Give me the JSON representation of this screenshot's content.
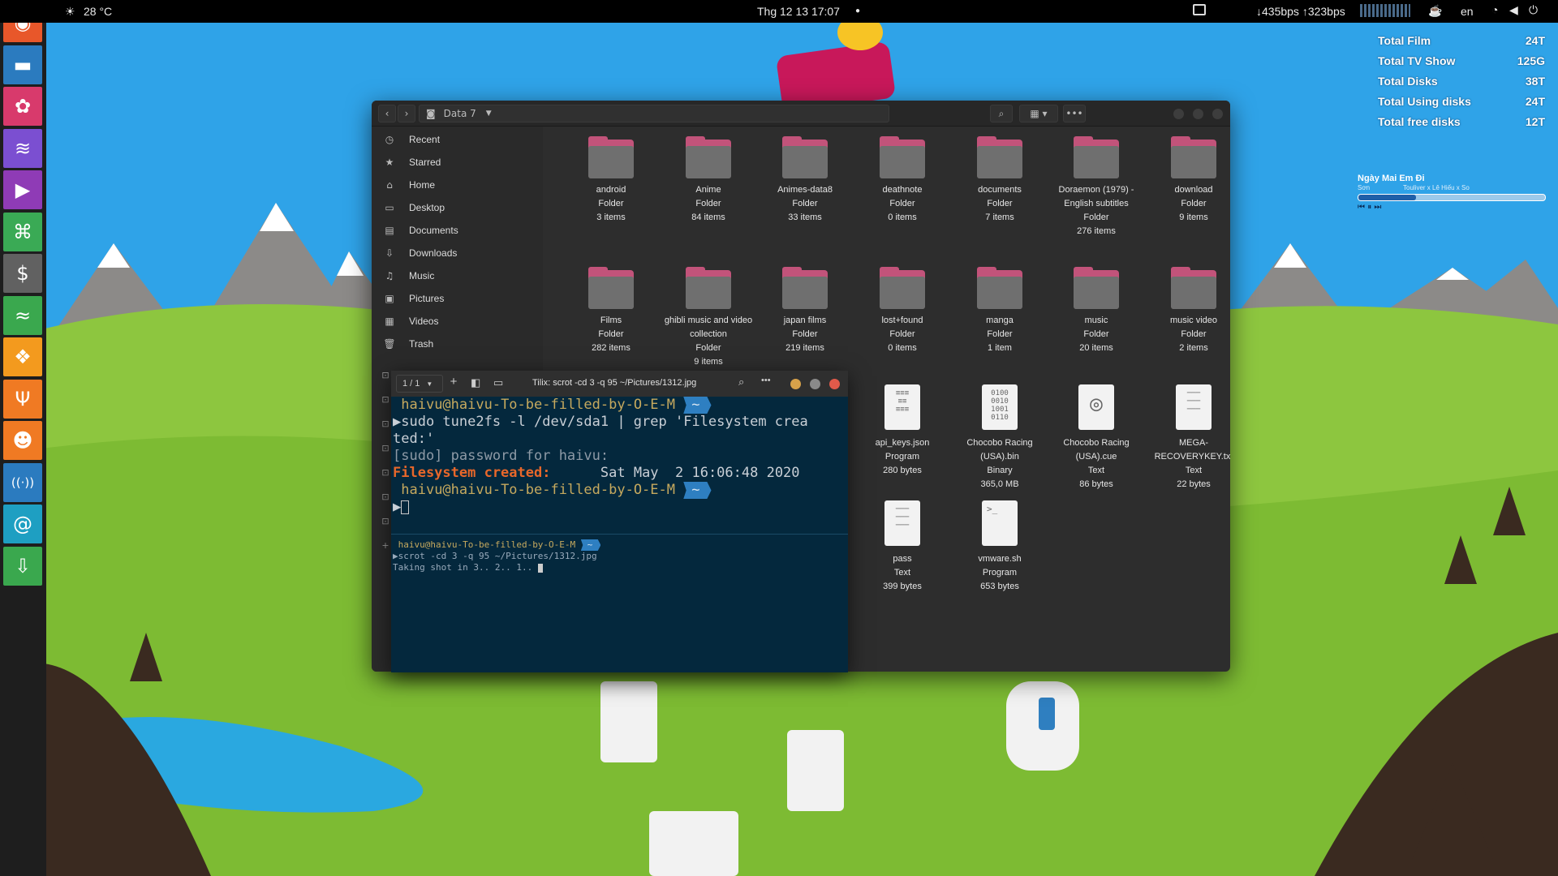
{
  "topbar": {
    "weather": "28 °C",
    "datetime": "Thg 12 13  17:07",
    "net": "↓435bps ↑323bps",
    "lang": "en"
  },
  "dock_icons": [
    "chrome-icon",
    "briefcase-icon",
    "pinwheel-icon",
    "waves-icon",
    "play-icon",
    "gamepad-icon",
    "dollar-icon",
    "wifi-waves-icon",
    "pineapple-icon",
    "cutlery-icon",
    "reddit-icon",
    "broadcast-icon",
    "at-icon",
    "download-icon"
  ],
  "dock_colors": [
    "#e8572a",
    "#2b7bbf",
    "#d83a6c",
    "#7b4fd1",
    "#8f3bb6",
    "#3aaa55",
    "#616161",
    "#3aa84e",
    "#f39a1e",
    "#f07a23",
    "#f07a23",
    "#2b7bbf",
    "#1e9fc2",
    "#3aa84e"
  ],
  "stats": [
    {
      "label": "Total Film",
      "value": "24T"
    },
    {
      "label": "Total TV Show",
      "value": "125G"
    },
    {
      "label": "Total Disks",
      "value": "38T"
    },
    {
      "label": "Total Using disks",
      "value": "24T"
    },
    {
      "label": "Total free disks",
      "value": "12T"
    }
  ],
  "player": {
    "title": "Ngày Mai Em Đi",
    "line_left": "Sơn",
    "line_right": "Touliver x Lê Hiếu x So",
    "progress": 0.31
  },
  "fm": {
    "location": "Data 7",
    "sidebar": [
      {
        "icon": "clock-icon",
        "glyph": "◷",
        "label": "Recent"
      },
      {
        "icon": "star-icon",
        "glyph": "★",
        "label": "Starred"
      },
      {
        "icon": "home-icon",
        "glyph": "⌂",
        "label": "Home"
      },
      {
        "icon": "desktop-icon",
        "glyph": "▭",
        "label": "Desktop"
      },
      {
        "icon": "documents-icon",
        "glyph": "▤",
        "label": "Documents"
      },
      {
        "icon": "downloads-icon",
        "glyph": "⇩",
        "label": "Downloads"
      },
      {
        "icon": "music-icon",
        "glyph": "♫",
        "label": "Music"
      },
      {
        "icon": "pictures-icon",
        "glyph": "▣",
        "label": "Pictures"
      },
      {
        "icon": "videos-icon",
        "glyph": "▦",
        "label": "Videos"
      },
      {
        "icon": "trash-icon",
        "glyph": "🗑",
        "label": "Trash"
      }
    ],
    "items": [
      {
        "name": "android",
        "type": "Folder",
        "info": "3 items",
        "kind": "folder"
      },
      {
        "name": "Anime",
        "type": "Folder",
        "info": "84 items",
        "kind": "folder"
      },
      {
        "name": "Animes-data8",
        "type": "Folder",
        "info": "33 items",
        "kind": "folder"
      },
      {
        "name": "deathnote",
        "type": "Folder",
        "info": "0 items",
        "kind": "folder"
      },
      {
        "name": "documents",
        "type": "Folder",
        "info": "7 items",
        "kind": "folder"
      },
      {
        "name": "Doraemon (1979) - English subtitles",
        "type": "Folder",
        "info": "276 items",
        "kind": "folder"
      },
      {
        "name": "download",
        "type": "Folder",
        "info": "9 items",
        "kind": "folder"
      },
      {
        "name": "Films",
        "type": "Folder",
        "info": "282 items",
        "kind": "folder"
      },
      {
        "name": "ghibli music and video collection",
        "type": "Folder",
        "info": "9 items",
        "kind": "folder"
      },
      {
        "name": "japan films",
        "type": "Folder",
        "info": "219 items",
        "kind": "folder"
      },
      {
        "name": "lost+found",
        "type": "Folder",
        "info": "0 items",
        "kind": "folder"
      },
      {
        "name": "manga",
        "type": "Folder",
        "info": "1 item",
        "kind": "folder"
      },
      {
        "name": "music",
        "type": "Folder",
        "info": "20 items",
        "kind": "folder"
      },
      {
        "name": "music video",
        "type": "Folder",
        "info": "2 items",
        "kind": "folder"
      },
      {
        "name": "api_keys.json",
        "type": "Program",
        "info": "280 bytes",
        "kind": "json"
      },
      {
        "name": "Chocobo Racing (USA).bin",
        "type": "Binary",
        "info": "365,0 MB",
        "kind": "bin"
      },
      {
        "name": "Chocobo Racing (USA).cue",
        "type": "Text",
        "info": "86 bytes",
        "kind": "cue"
      },
      {
        "name": "MEGA-RECOVERYKEY.txt",
        "type": "Text",
        "info": "22 bytes",
        "kind": "txt"
      },
      {
        "name": "pass",
        "type": "Text",
        "info": "399 bytes",
        "kind": "txt"
      },
      {
        "name": "vmware.sh",
        "type": "Program",
        "info": "653 bytes",
        "kind": "sh"
      }
    ]
  },
  "term": {
    "tabs": "1 / 1",
    "title": "Tilix: scrot -cd 3 -q 95 ~/Pictures/1312.jpg",
    "prompt": "haivu@haivu-To-be-filled-by-O-E-M",
    "cmd": "▶sudo tune2fs -l /dev/sda1 | grep 'Filesystem crea",
    "cmd2": "ted:'",
    "pw": "[sudo] password for haivu:",
    "fs_label": "Filesystem created:",
    "fs_date": "Sat May  2 16:06:48 2020",
    "cursor_line": "▶",
    "prompt2": "haivu@haivu-To-be-filled-by-O-E-M",
    "cmd3": "▶scrot -cd 3 -q 95 ~/Pictures/1312.jpg",
    "out3": "Taking shot in 3.. 2.. 1..",
    "tilde": "~"
  }
}
